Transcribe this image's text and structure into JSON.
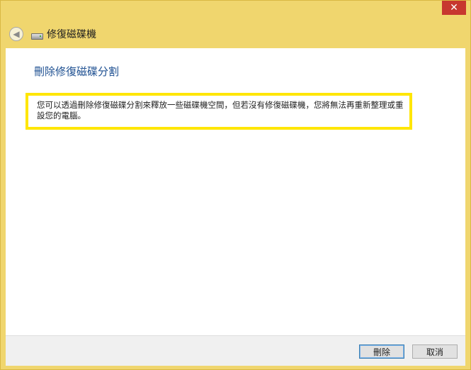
{
  "window": {
    "close_glyph": "✕",
    "nav_title": "修復磁碟機"
  },
  "content": {
    "heading": "刪除修復磁碟分割",
    "description": "您可以透過刪除修復磁碟分割來釋放一些磁碟機空間，但若沒有修復磁碟機，您將無法再重新整理或重設您的電腦。"
  },
  "footer": {
    "delete_label": "刪除",
    "cancel_label": "取消"
  },
  "colors": {
    "frame": "#f0d66e",
    "heading": "#1d4f91",
    "highlight": "#ffe600",
    "close": "#c7372f"
  },
  "icons": {
    "back": "back-arrow-icon",
    "drive": "drive-icon",
    "close": "close-icon"
  }
}
